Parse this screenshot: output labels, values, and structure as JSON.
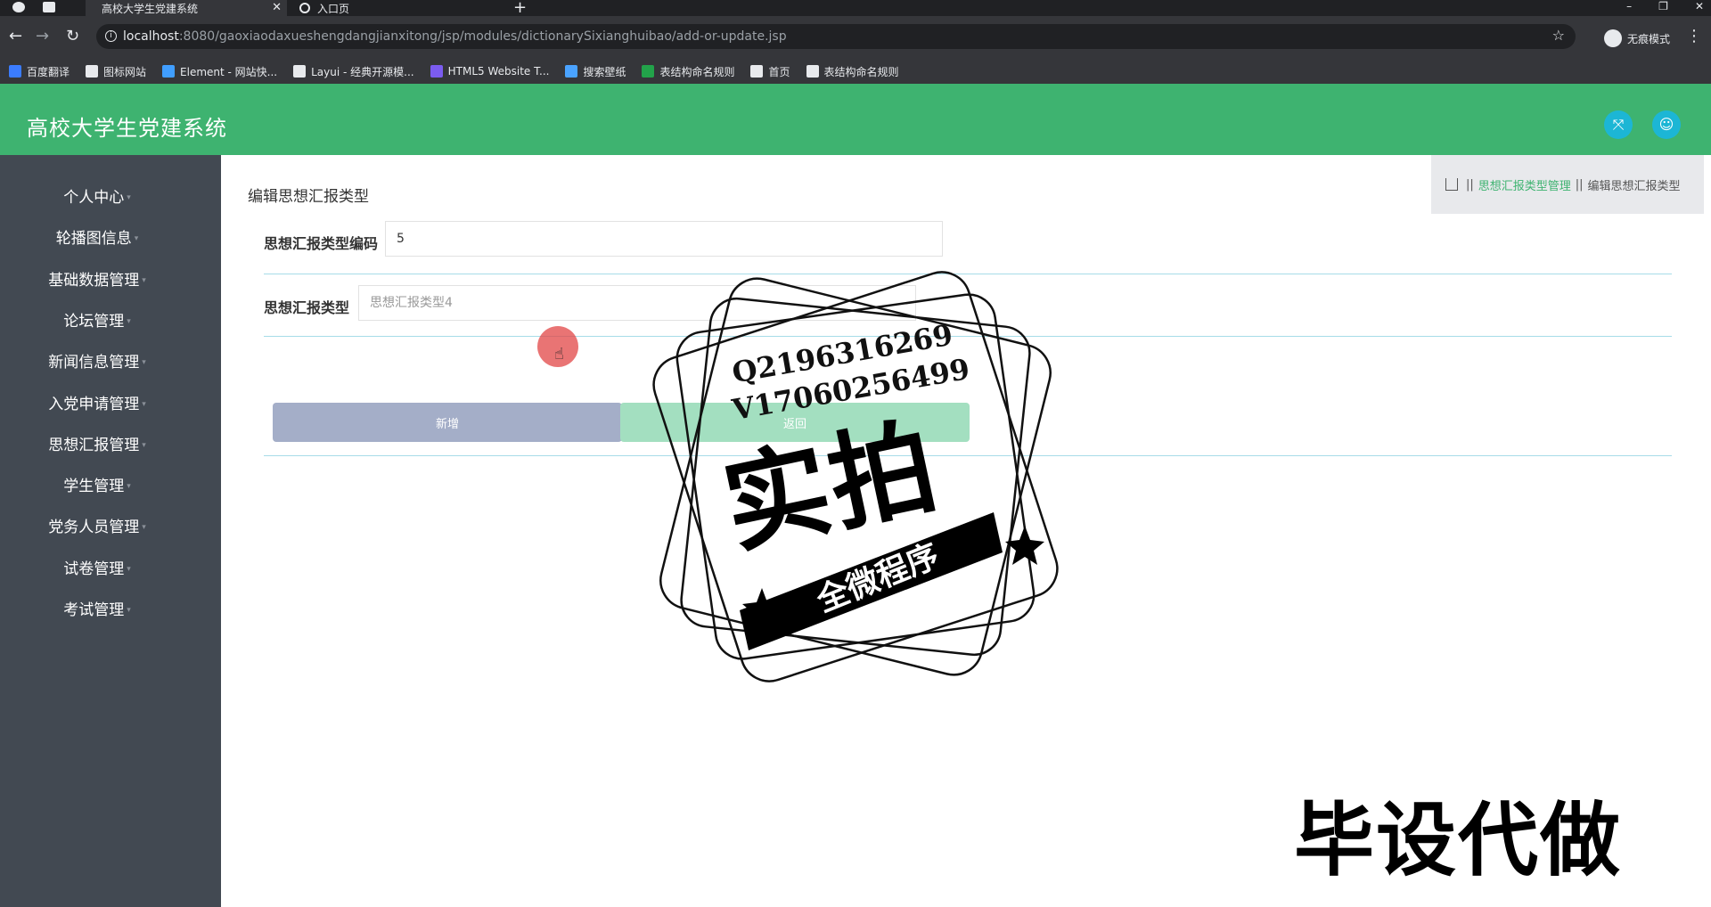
{
  "browser": {
    "tabs": [
      {
        "title": "高校大学生党建系统",
        "active": true
      },
      {
        "title": "入口页",
        "active": false
      }
    ],
    "url_host": "localhost",
    "url_rest": ":8080/gaoxiaodaxueshengdangjianxitong/jsp/modules/dictionarySixianghuibao/add-or-update.jsp",
    "incognito_label": "无痕模式",
    "bookmarks": [
      {
        "label": "百度翻译",
        "color": "#3b7cff"
      },
      {
        "label": "图标网站",
        "color": "#e8eaed"
      },
      {
        "label": "Element - 网站快...",
        "color": "#409eff"
      },
      {
        "label": "Layui - 经典开源模...",
        "color": "#e8eaed"
      },
      {
        "label": "HTML5 Website T...",
        "color": "#7b5cf0"
      },
      {
        "label": "搜索壁纸",
        "color": "#4aa3ff"
      },
      {
        "label": "表结构命名规则",
        "color": "#22a34a"
      },
      {
        "label": "首页",
        "color": "#e8eaed"
      },
      {
        "label": "表结构命名规则",
        "color": "#e8eaed"
      }
    ]
  },
  "app": {
    "title": "高校大学生党建系统",
    "colors": {
      "header": "#3eb370",
      "sidebar": "#424952",
      "accent_button": "#1cb6d5"
    },
    "sidebar": [
      {
        "label": "个人中心"
      },
      {
        "label": "轮播图信息"
      },
      {
        "label": "基础数据管理"
      },
      {
        "label": "论坛管理"
      },
      {
        "label": "新闻信息管理"
      },
      {
        "label": "入党申请管理"
      },
      {
        "label": "思想汇报管理"
      },
      {
        "label": "学生管理"
      },
      {
        "label": "党务人员管理"
      },
      {
        "label": "试卷管理"
      },
      {
        "label": "考试管理"
      }
    ]
  },
  "page": {
    "title": "编辑思想汇报类型",
    "breadcrumb": {
      "link": "思想汇报类型管理",
      "current": "编辑思想汇报类型"
    },
    "form": {
      "code_label": "思想汇报类型编码",
      "code_value": "5",
      "type_label": "思想汇报类型",
      "type_placeholder": "思想汇报类型4"
    },
    "buttons": {
      "add": "新增",
      "back": "返回"
    }
  },
  "watermark": {
    "phone_q": "Q2196316269",
    "phone_v": "V17060256499",
    "big_text": "实拍",
    "banner_text": "全微程序",
    "bottom_text": "毕设代做"
  }
}
